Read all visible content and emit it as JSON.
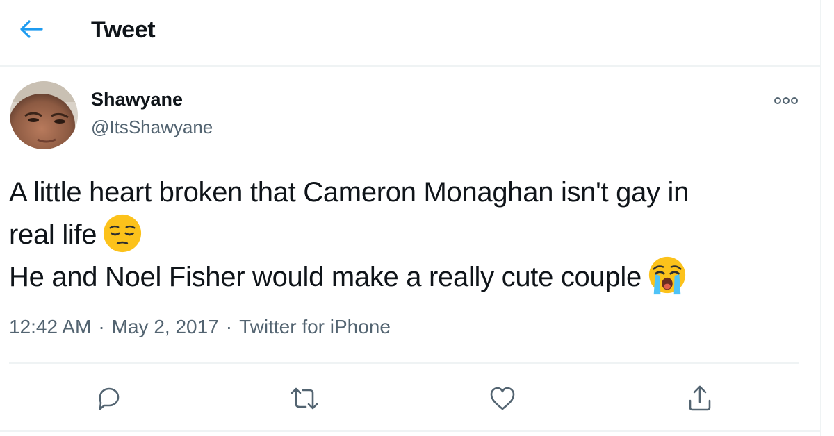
{
  "header": {
    "title": "Tweet",
    "back_icon": "arrow-left-icon",
    "accent_color": "#1d9bf0"
  },
  "tweet": {
    "author": {
      "display_name": "Shawyane",
      "handle": "@ItsShawyane",
      "avatar": "profile-photo"
    },
    "more_icon": "more-options-icon",
    "text_lines": [
      "A little heart broken that Cameron Monaghan isn't gay in",
      "real life",
      "He and Noel Fisher would make a really cute couple"
    ],
    "emojis": [
      "pensive-face-emoji",
      "loudly-crying-face-emoji"
    ],
    "time": "12:42 AM",
    "date": "May 2, 2017",
    "separator": "·",
    "source": "Twitter for iPhone"
  },
  "actions": [
    {
      "name": "reply",
      "icon": "reply-icon"
    },
    {
      "name": "retweet",
      "icon": "retweet-icon"
    },
    {
      "name": "like",
      "icon": "heart-icon"
    },
    {
      "name": "share",
      "icon": "share-icon"
    }
  ],
  "colors": {
    "primary_text": "#0f1419",
    "secondary_text": "#536471",
    "divider": "#eff3f4",
    "accent": "#1d9bf0"
  }
}
